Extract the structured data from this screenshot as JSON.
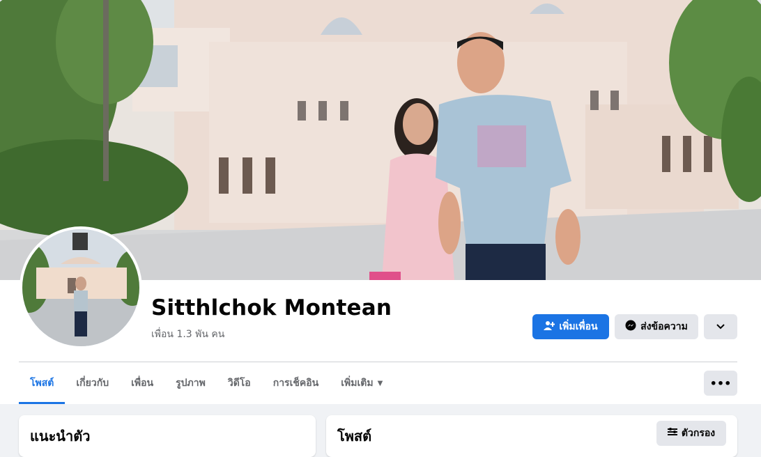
{
  "profile": {
    "name": "Sitthlchok Montean",
    "friends_text": "เพื่อน 1.3 พัน คน"
  },
  "actions": {
    "add_friend_label": "เพิ่มเพื่อน",
    "message_label": "ส่งข้อความ",
    "more_icon": "chevron-down-icon"
  },
  "tabs": [
    {
      "label": "โพสต์",
      "active": true
    },
    {
      "label": "เกี่ยวกับ",
      "active": false
    },
    {
      "label": "เพื่อน",
      "active": false
    },
    {
      "label": "รูปภาพ",
      "active": false
    },
    {
      "label": "วิดีโอ",
      "active": false
    },
    {
      "label": "การเช็คอิน",
      "active": false
    },
    {
      "label": "เพิ่มเติม",
      "active": false
    }
  ],
  "tab_overflow_label": "•••",
  "intro_card": {
    "title": "แนะนำตัว"
  },
  "posts_card": {
    "title": "โพสต์",
    "filter_label": "ตัวกรอง"
  },
  "colors": {
    "accent": "#1b74e4",
    "secondary_button": "#e4e6eb",
    "page_background": "#f0f2f5",
    "muted_text": "#65676b"
  }
}
